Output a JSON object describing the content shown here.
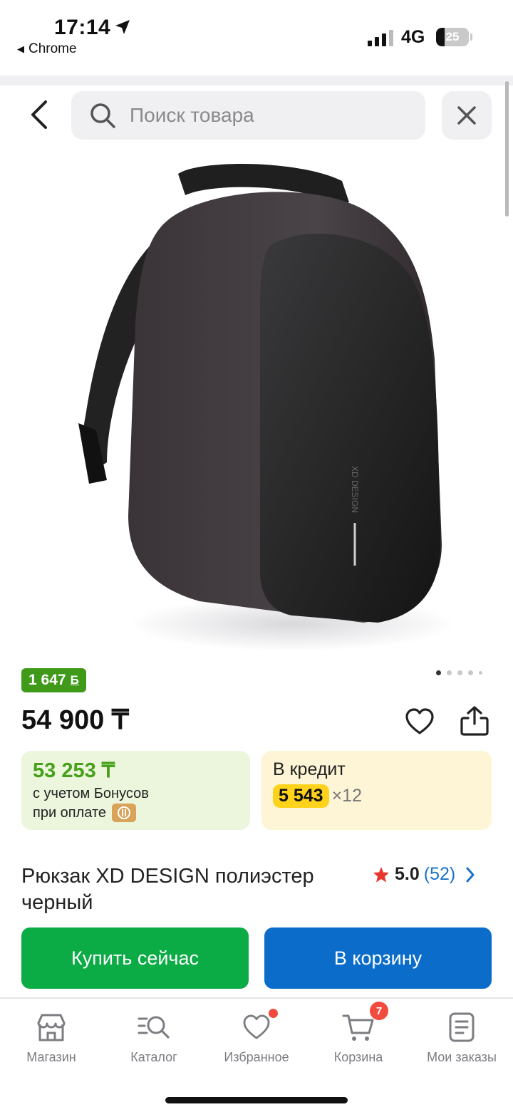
{
  "status_bar": {
    "time": "17:14",
    "back_app": "Chrome",
    "network": "4G",
    "battery": "25",
    "battery_level": 0.25,
    "icons": [
      "location-arrow-icon",
      "signal-icon",
      "battery-icon"
    ]
  },
  "header": {
    "search_placeholder": "Поиск товара",
    "icons": [
      "back-chevron-icon",
      "search-icon",
      "close-icon"
    ]
  },
  "product": {
    "image_icon": "backpack-image",
    "image_index": 1,
    "image_count": 5,
    "bonus_amount": "1 647",
    "bonus_symbol": "Б",
    "price": "54 900 ₸",
    "title": "Рюкзак XD DESIGN полиэстер черный",
    "rating_score": "5.0",
    "rating_count": "(52)",
    "rating_stars": 5.0
  },
  "bonus_card": {
    "price_with_bonus": "53 253 ₸",
    "line1": "с учетом Бонусов",
    "line2": "при оплате"
  },
  "credit_card": {
    "title": "В кредит",
    "monthly": "5 543",
    "months": "×12"
  },
  "actions": {
    "buy_now": "Купить сейчас",
    "add_to_cart": "В корзину"
  },
  "bottom_nav": {
    "items": [
      {
        "label": "Магазин",
        "icon": "store-icon"
      },
      {
        "label": "Каталог",
        "icon": "catalog-search-icon"
      },
      {
        "label": "Избранное",
        "icon": "heart-icon"
      },
      {
        "label": "Корзина",
        "icon": "cart-icon"
      },
      {
        "label": "Мои заказы",
        "icon": "orders-icon"
      }
    ],
    "cart_count": "7"
  },
  "colors": {
    "green_button": "#0bab45",
    "blue_button": "#0b6dc9",
    "bonus_green": "#3f9a1a",
    "credit_yellow": "#ffd21c",
    "link_blue": "#1a72c8",
    "badge_red": "#f04b3c"
  }
}
